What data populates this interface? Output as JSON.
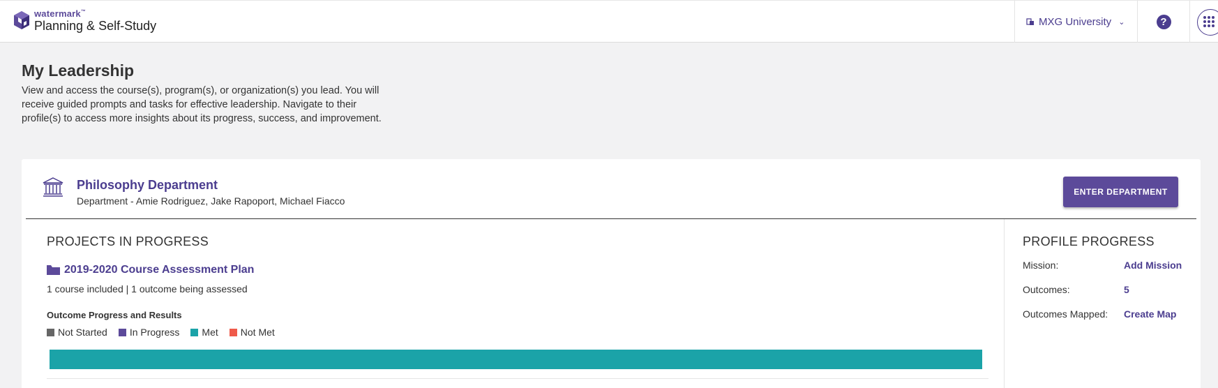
{
  "brand": {
    "small": "watermark",
    "tm": "™",
    "product": "Planning & Self-Study"
  },
  "topbar": {
    "org_name": "MXG University",
    "help_label": "?"
  },
  "page": {
    "title": "My Leadership",
    "description": "View and access the course(s), program(s), or organization(s) you lead. You will receive guided prompts and tasks for effective leadership. Navigate to their profile(s) to access more insights about its progress, success, and improvement."
  },
  "department": {
    "name": "Philosophy Department",
    "subtitle": "Department - Amie Rodriguez, Jake Rapoport, Michael Fiacco",
    "enter_label": "ENTER DEPARTMENT"
  },
  "projects": {
    "section_title": "PROJECTS IN PROGRESS",
    "project_name": "2019-2020 Course Assessment Plan",
    "meta": "1 course included | 1 outcome being assessed",
    "outcome_label": "Outcome Progress and Results",
    "legend": [
      {
        "label": "Not Started",
        "color": "#666666"
      },
      {
        "label": "In Progress",
        "color": "#5c4a9a"
      },
      {
        "label": "Met",
        "color": "#1ba3a8"
      },
      {
        "label": "Not Met",
        "color": "#ef5a4a"
      }
    ],
    "progress": {
      "not_started": 0,
      "in_progress": 0,
      "met": 1,
      "not_met": 0
    }
  },
  "profile": {
    "section_title": "PROFILE PROGRESS",
    "rows": [
      {
        "label": "Mission:",
        "value": "Add Mission"
      },
      {
        "label": "Outcomes:",
        "value": "5"
      },
      {
        "label": "Outcomes Mapped:",
        "value": "Create Map"
      }
    ]
  },
  "colors": {
    "accent": "#4b3d8f",
    "button": "#5c4a9a",
    "met": "#1ba3a8"
  }
}
